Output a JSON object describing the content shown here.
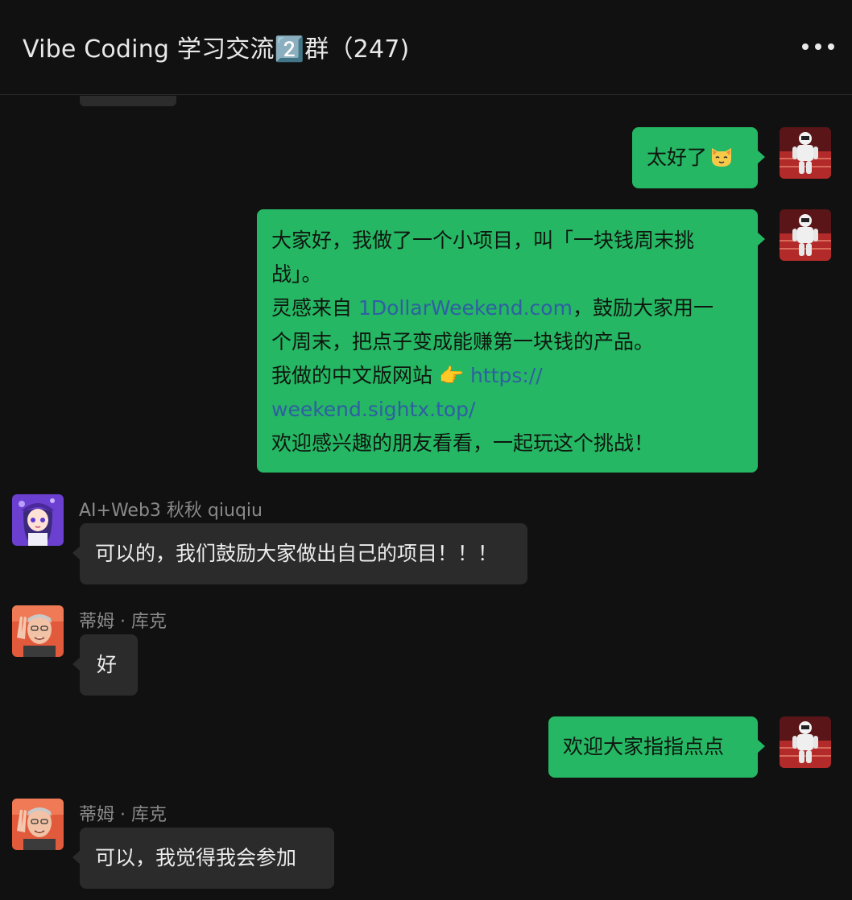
{
  "header": {
    "title": "Vibe Coding 学习交流2️⃣群（247)"
  },
  "messages": [
    {
      "side": "right",
      "text": "太好了",
      "emoji": "cat-face"
    },
    {
      "side": "right",
      "lines": [
        {
          "text": "大家好，我做了一个小项目，叫「一块钱周末挑"
        },
        {
          "text": "战」。"
        },
        {
          "pre": "灵感来自 ",
          "link": "1DollarWeekend.com",
          "post": "，鼓励大家用一"
        },
        {
          "text": "个周末，把点子变成能赚第一块钱的产品。"
        },
        {
          "pre": "我做的中文版网站 👉 ",
          "link": "https://"
        },
        {
          "link": "weekend.sightx.top/"
        },
        {
          "text": "欢迎感兴趣的朋友看看，一起玩这个挑战！"
        }
      ]
    },
    {
      "side": "left",
      "sender": "AI+Web3 秋秋 qiuqiu",
      "text": "可以的，我们鼓励大家做出自己的项目！！！"
    },
    {
      "side": "left",
      "sender": "蒂姆 · 库克",
      "text": "好"
    },
    {
      "side": "right",
      "text": "欢迎大家指指点点"
    },
    {
      "side": "left",
      "sender": "蒂姆 · 库克",
      "text": "可以，我觉得我会参加"
    }
  ],
  "colors": {
    "background": "#111111",
    "green_bubble": "#25b763",
    "gray_bubble": "#2b2b2b",
    "link": "#2f5fa3"
  }
}
